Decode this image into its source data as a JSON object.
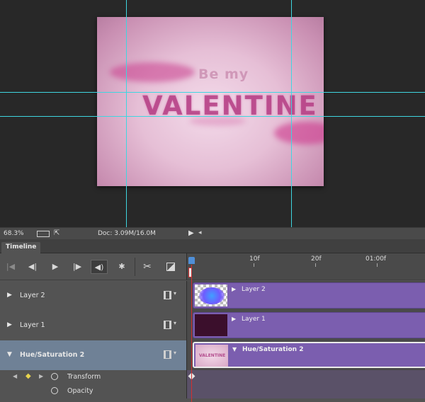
{
  "canvas": {
    "artwork_small": "Be my",
    "artwork_big": "VALENTINE"
  },
  "status_bar": {
    "zoom": "68.3%",
    "doc_size": "Doc: 3.09M/16.0M"
  },
  "panel": {
    "tab": "Timeline"
  },
  "controls": {
    "first_frame_icon": "go-to-first-frame-icon",
    "prev_frame_icon": "previous-frame-icon",
    "play_icon": "play-icon",
    "next_frame_icon": "next-frame-icon",
    "audio_icon": "speaker-icon",
    "settings_icon": "gear-icon",
    "split_icon": "scissors-icon",
    "transition_icon": "transition-icon"
  },
  "ruler": {
    "ticks": [
      "10f",
      "20f",
      "01:00f"
    ]
  },
  "tracks": [
    {
      "name": "Layer 2",
      "clip": "Layer 2",
      "selected": false
    },
    {
      "name": "Layer 1",
      "clip": "Layer 1",
      "selected": false
    },
    {
      "name": "Hue/Saturation 2",
      "clip": "Hue/Saturation 2",
      "selected": true
    }
  ],
  "thumb_text": "VALENTINE",
  "properties": [
    {
      "name": "Transform"
    },
    {
      "name": "Opacity"
    }
  ],
  "colors": {
    "guide": "#3fd6e0",
    "clip": "#7b5eaf",
    "playhead": "#d23030",
    "selected_track": "#6f8196"
  }
}
